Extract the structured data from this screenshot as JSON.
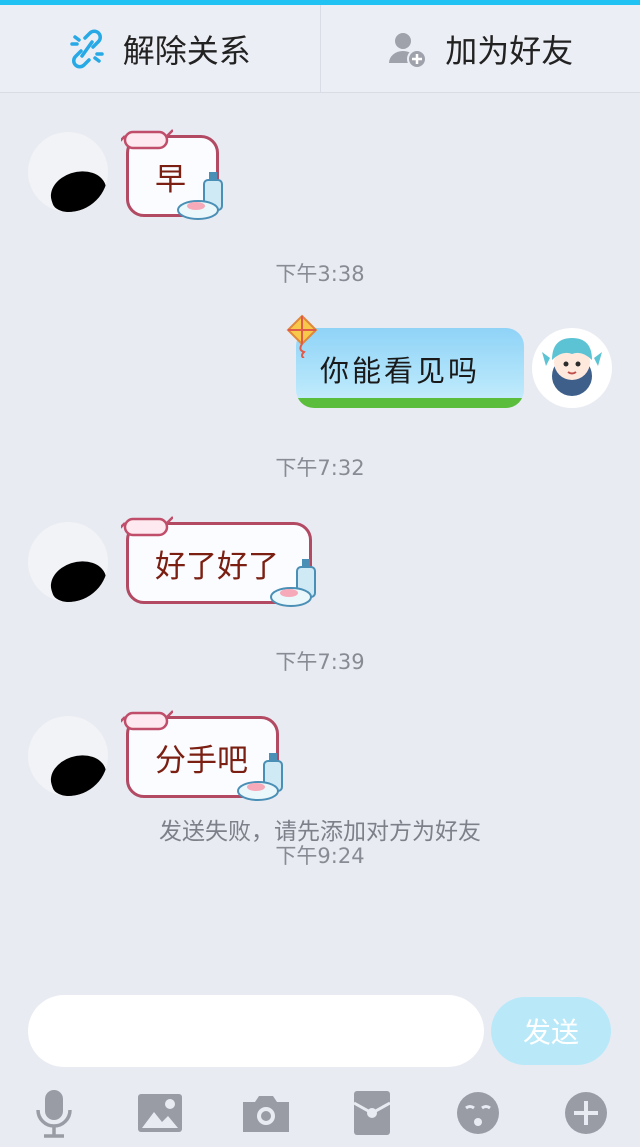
{
  "header": {
    "unlink_label": "解除关系",
    "add_friend_label": "加为好友"
  },
  "messages": [
    {
      "direction": "in",
      "text": "早"
    },
    {
      "type": "time",
      "text": "下午3:38"
    },
    {
      "direction": "out",
      "text": "你能看见吗"
    },
    {
      "type": "time",
      "text": "下午7:32"
    },
    {
      "direction": "in",
      "text": "好了好了"
    },
    {
      "type": "time",
      "text": "下午7:39"
    },
    {
      "direction": "in",
      "text": "分手吧"
    },
    {
      "type": "time",
      "text": "下午9:24"
    }
  ],
  "status_notice": "发送失败，请先添加对方为好友",
  "composer": {
    "input_value": "",
    "send_label": "发送"
  },
  "toolbar_icons": [
    "microphone-icon",
    "image-icon",
    "camera-icon",
    "red-packet-icon",
    "emoji-icon",
    "plus-icon"
  ],
  "colors": {
    "accent": "#20c2f3",
    "incoming_text": "#7a1f12",
    "bubble_border": "#b24a63",
    "send_button": "#b9e9f9",
    "icon_gray": "#9a9ca5",
    "background": "#e9ebf3"
  }
}
